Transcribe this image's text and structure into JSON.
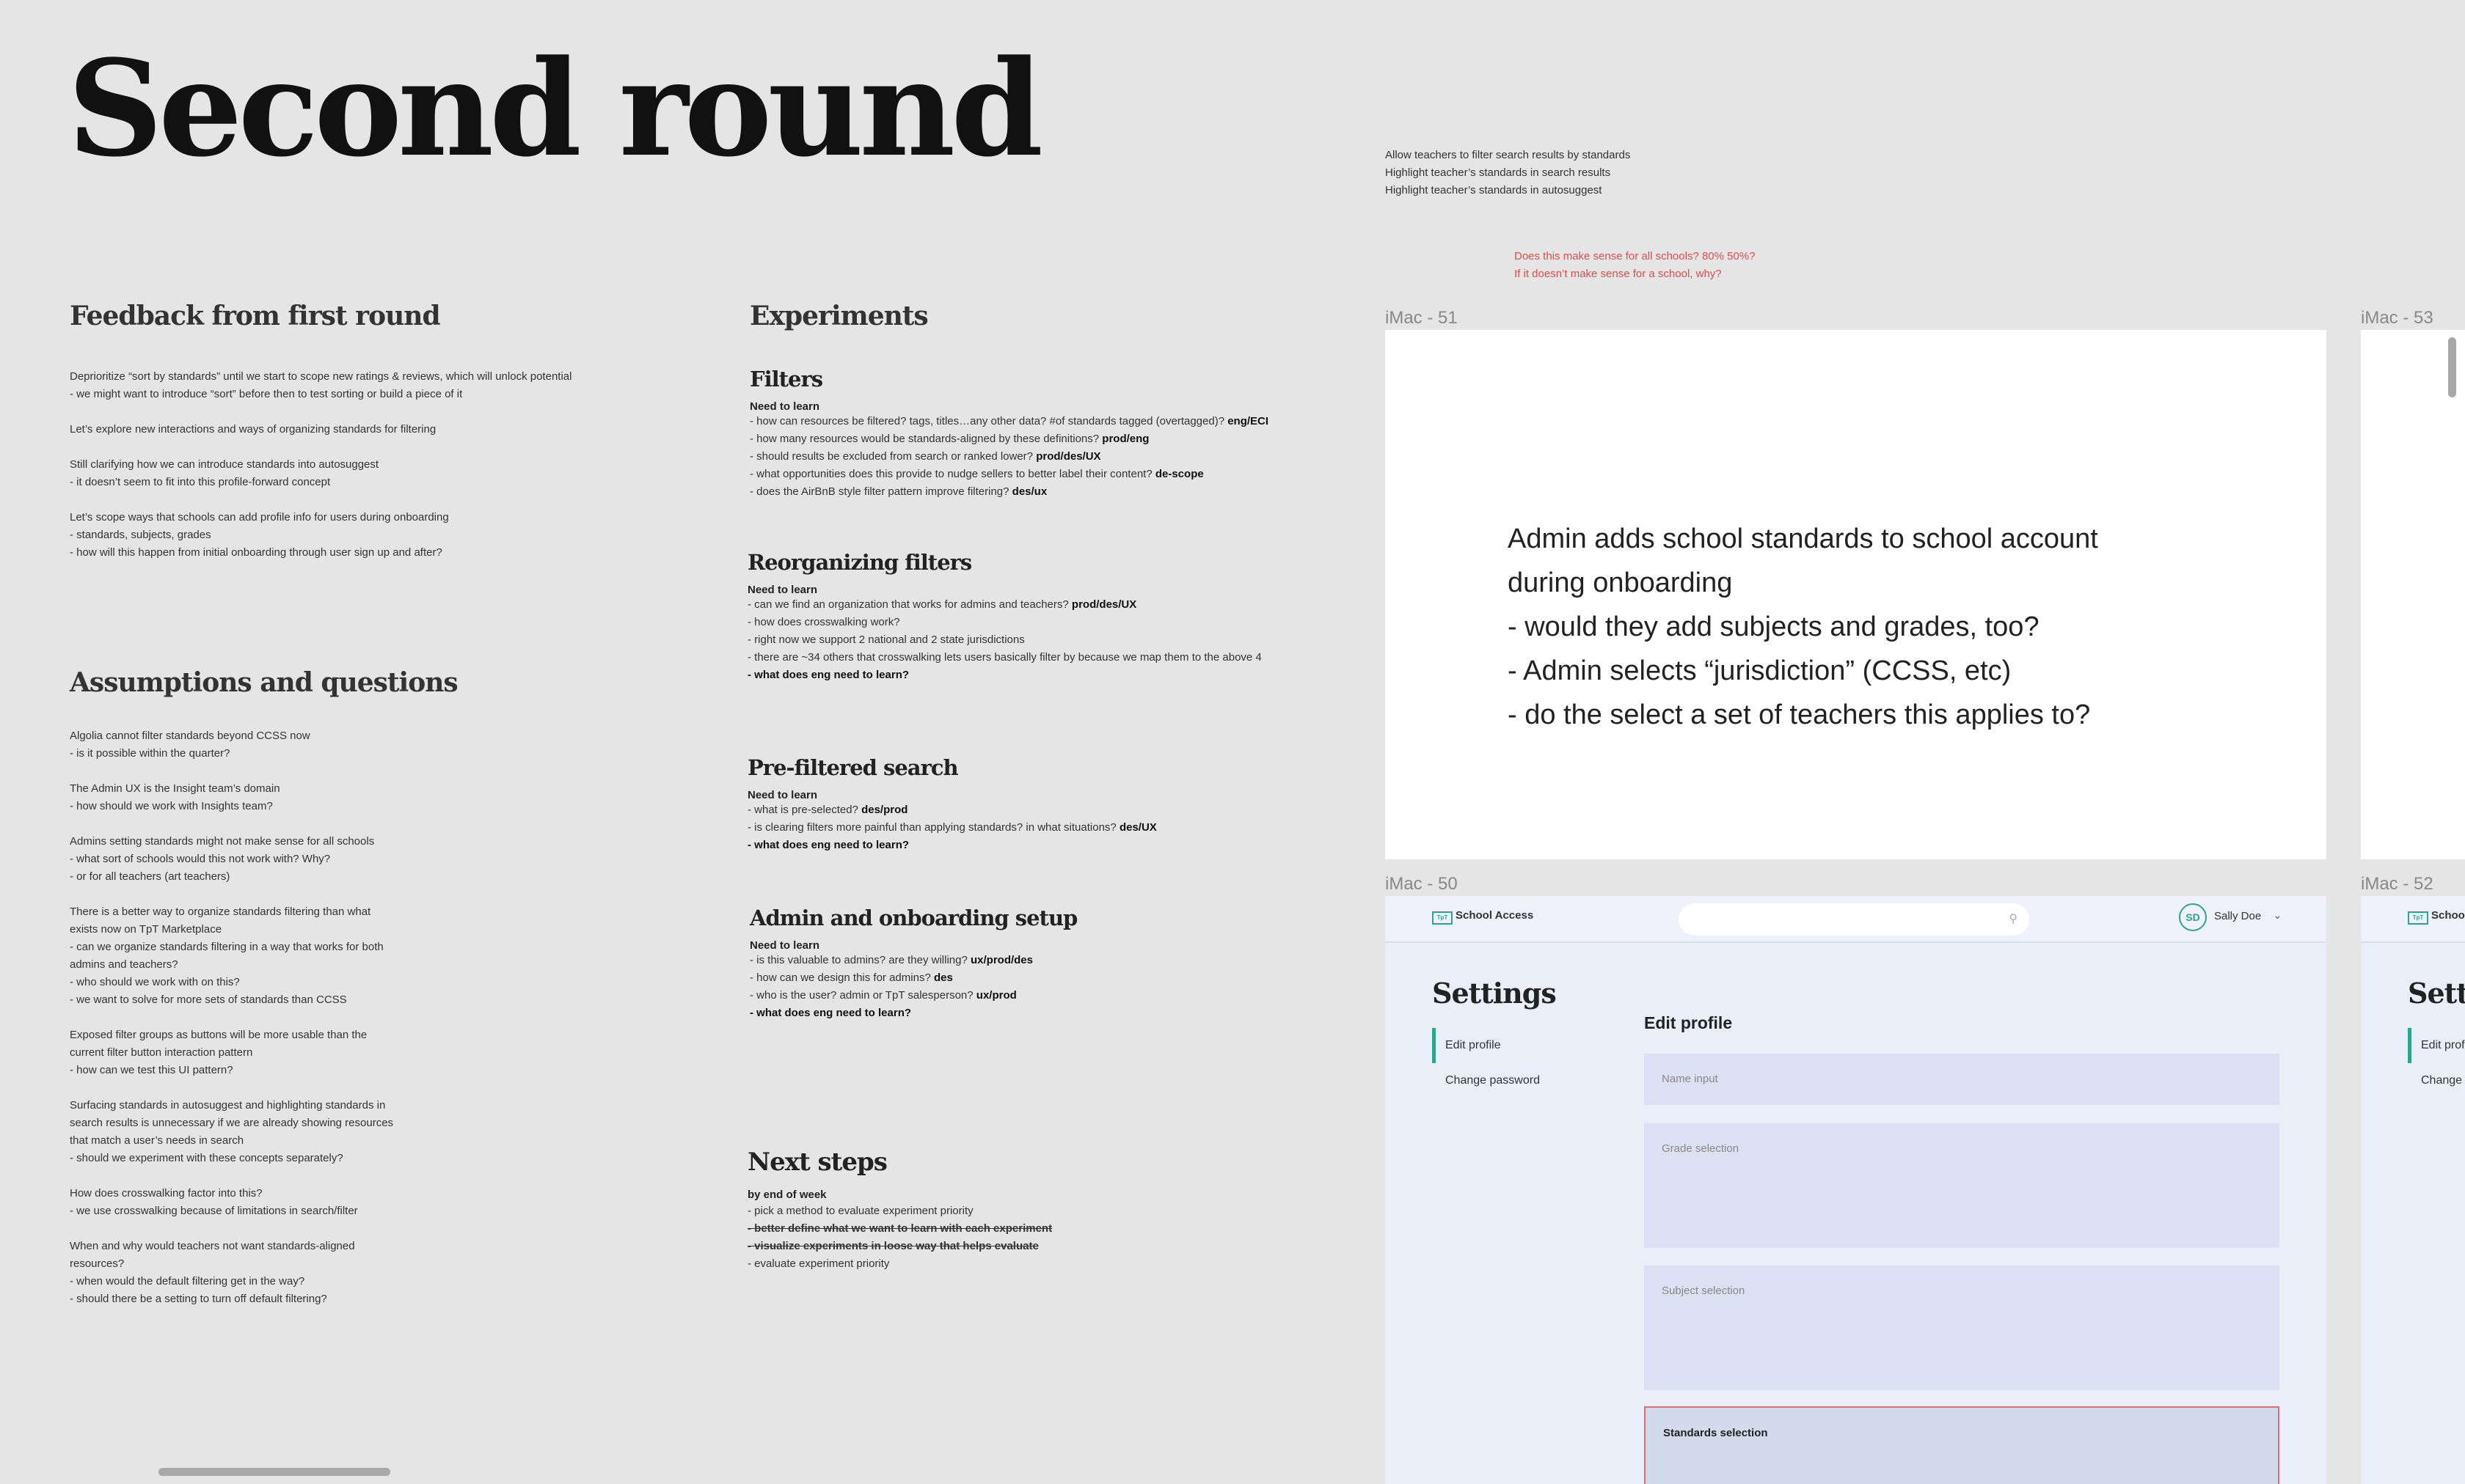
{
  "title": "Second round",
  "goals": [
    "Allow teachers to filter search results by standards",
    "Highlight teacher’s standards in search results",
    "Highlight teacher’s standards in autosuggest"
  ],
  "red_note": [
    "Does this make sense for all schools? 80% 50%?",
    "If it doesn’t make sense for a school, why?"
  ],
  "feedback": {
    "heading": "Feedback from first round",
    "lines": [
      "Deprioritize “sort by standards” until we start to scope new ratings & reviews, which will unlock potential",
      " - we might want to introduce “sort” before then to test sorting or build a piece of it",
      "",
      "Let’s explore new interactions and ways of organizing standards for filtering",
      "",
      "Still clarifying how we can introduce standards into autosuggest",
      " - it doesn’t seem to fit into this profile-forward concept",
      "",
      "Let’s scope ways that schools can add profile info for users during onboarding",
      " - standards, subjects, grades",
      " - how will this happen from initial onboarding through user sign up and after?"
    ]
  },
  "assumptions": {
    "heading": "Assumptions and questions",
    "lines": [
      "Algolia cannot filter standards beyond CCSS now",
      " - is it possible within the quarter?",
      "",
      "The Admin UX is the Insight team’s domain",
      " - how should we work with Insights team?",
      "",
      "Admins setting standards might not make sense for all schools",
      " - what sort of schools would this not work with? Why?",
      " - or for all teachers (art teachers)",
      "",
      "There is a better way to organize standards filtering than what",
      "exists now on TpT Marketplace",
      " - can we organize standards filtering in a way that works for both",
      "admins and teachers?",
      " - who should we work with on this?",
      " - we want to solve for more sets of standards than CCSS",
      "",
      "Exposed filter groups as buttons will be more usable than the",
      "current filter button interaction pattern",
      " - how can we test this UI pattern?",
      "",
      "Surfacing standards in autosuggest and highlighting standards in",
      "search results is unnecessary if we are already showing resources",
      "that match a user’s needs in search",
      " - should we experiment with these concepts separately?",
      "",
      "How does crosswalking factor into this?",
      " - we use crosswalking because of limitations in search/filter",
      "",
      "When and why would teachers not want standards-aligned",
      "resources?",
      " - when would the default filtering get in the way?",
      " - should there be a setting to turn off default filtering?"
    ]
  },
  "experiments": {
    "heading": "Experiments",
    "sections": [
      {
        "title": "Filters",
        "sub": "Need to learn",
        "lines": [
          {
            "t": " - how can resources be filtered? tags, titles…any other data? #of standards tagged (overtagged)? ",
            "tag": "eng/ECI"
          },
          {
            "t": " - how many resources would be standards-aligned by these definitions? ",
            "tag": "prod/eng"
          },
          {
            "t": " - should results be excluded from search or ranked lower? ",
            "tag": "prod/des/UX"
          },
          {
            "t": " - what opportunities does this provide to nudge sellers to better label their content? ",
            "tag": "de-scope"
          },
          {
            "t": " - does the AirBnB style filter pattern improve filtering? ",
            "tag": "des/ux"
          }
        ]
      },
      {
        "title": "Reorganizing filters",
        "sub": "Need to learn",
        "lines": [
          {
            "t": " - can we find an organization that works for admins and teachers? ",
            "tag": "prod/des/UX"
          },
          {
            "t": " - how does crosswalking work?",
            "tag": ""
          },
          {
            "t": " - right now we support 2 national and 2 state jurisdictions",
            "tag": ""
          },
          {
            "t": " - there are ~34 others that crosswalking lets users basically filter by because we map them to the above 4",
            "tag": ""
          },
          {
            "t": "",
            "tag": " - what does eng need to learn?"
          }
        ]
      },
      {
        "title": "Pre-filtered search",
        "sub": "Need to learn",
        "lines": [
          {
            "t": " - what is pre-selected? ",
            "tag": "des/prod"
          },
          {
            "t": " - is clearing filters more painful than applying standards? in what situations? ",
            "tag": "des/UX"
          },
          {
            "t": "",
            "tag": " - what does eng need to learn?"
          }
        ]
      },
      {
        "title": "Admin and onboarding setup",
        "sub": "Need to learn",
        "lines": [
          {
            "t": " - is this valuable to admins? are they willing? ",
            "tag": "ux/prod/des"
          },
          {
            "t": " - how can we design this for admins? ",
            "tag": "des"
          },
          {
            "t": " - who is the user? admin or TpT salesperson? ",
            "tag": "ux/prod"
          },
          {
            "t": "",
            "tag": " - what does eng need to learn?"
          }
        ]
      }
    ]
  },
  "next_steps": {
    "heading": "Next steps",
    "sub": "by end of week",
    "items": [
      {
        "t": " - pick a method to evaluate experiment priority",
        "done": false
      },
      {
        "t": " - better define what we want to learn with each experiment",
        "done": true
      },
      {
        "t": " - visualize experiments in loose way that helps evaluate",
        "done": true
      },
      {
        "t": " - evaluate experiment priority",
        "done": false
      }
    ]
  },
  "frames": {
    "imac51": {
      "label": "iMac - 51",
      "lines": [
        "Admin adds school standards to school account",
        "during onboarding",
        " - would they add subjects and grades, too?",
        " - Admin selects “jurisdiction” (CCSS, etc)",
        " - do the select a set of teachers this applies to?"
      ]
    },
    "imac53": {
      "label": "iMac - 53"
    },
    "imac50": {
      "label": "iMac - 50",
      "logo_badge": "TpT",
      "logo_text": "School Access",
      "avatar_initials": "SD",
      "user_name": "Sally Doe",
      "settings_title": "Settings",
      "side_items": [
        "Edit profile",
        "Change password"
      ],
      "edit_title": "Edit profile",
      "fields": [
        "Name input",
        "Grade selection",
        "Subject selection",
        "Standards selection"
      ]
    },
    "imac52": {
      "label": "iMac - 52",
      "logo_badge": "TpT",
      "logo_text": "School",
      "settings_title": "Setti",
      "side_items": [
        "Edit prof",
        "Change"
      ]
    }
  },
  "colors": {
    "accent": "#2ca58d",
    "alert": "#e04b4b",
    "canvas": "#e5e5e5"
  }
}
